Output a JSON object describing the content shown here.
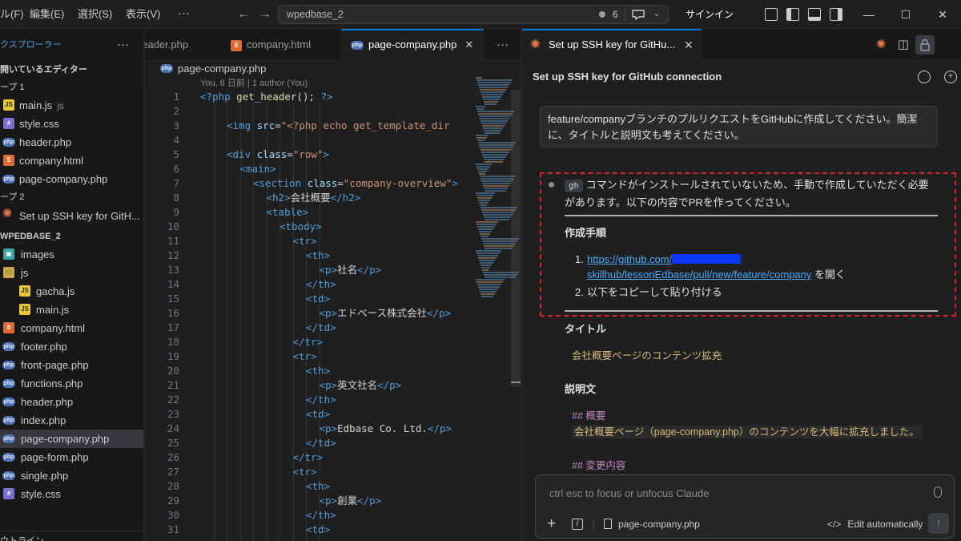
{
  "titlebar": {
    "menus": [
      "ル(F)",
      "編集(E)",
      "選択(S)",
      "表示(V)"
    ],
    "more": "···",
    "search_text": "wpedbase_2",
    "count": "6",
    "signin": "サインイン"
  },
  "sidebar": {
    "header": "クスプローラー",
    "open_editors": "開いているエディター",
    "group1": "ープ 1",
    "group1_items": [
      {
        "label": "main.js",
        "suffix": "js",
        "type": "js"
      },
      {
        "label": "style.css",
        "type": "css"
      },
      {
        "label": "header.php",
        "type": "php"
      },
      {
        "label": "company.html",
        "type": "html"
      },
      {
        "label": "page-company.php",
        "type": "php"
      }
    ],
    "group2": "ープ 2",
    "group2_items": [
      {
        "label": "Set up SSH key for GitH...",
        "type": "claude"
      }
    ],
    "project": "WPEDBASE_2",
    "tree": [
      {
        "label": "images",
        "type": "img",
        "indent": 0
      },
      {
        "label": "js",
        "type": "fold",
        "indent": 0
      },
      {
        "label": "gacha.js",
        "type": "js",
        "indent": 1
      },
      {
        "label": "main.js",
        "type": "js",
        "indent": 1
      },
      {
        "label": "company.html",
        "type": "html",
        "indent": 0
      },
      {
        "label": "footer.php",
        "type": "php",
        "indent": 0
      },
      {
        "label": "front-page.php",
        "type": "php",
        "indent": 0
      },
      {
        "label": "functions.php",
        "type": "php",
        "indent": 0
      },
      {
        "label": "header.php",
        "type": "php",
        "indent": 0
      },
      {
        "label": "index.php",
        "type": "php",
        "indent": 0
      },
      {
        "label": "page-company.php",
        "type": "php",
        "indent": 0,
        "active": true
      },
      {
        "label": "page-form.php",
        "type": "php",
        "indent": 0
      },
      {
        "label": "single.php",
        "type": "php",
        "indent": 0
      },
      {
        "label": "style.css",
        "type": "css",
        "indent": 0
      }
    ],
    "outline": "ウトライン"
  },
  "editor": {
    "tabs": [
      {
        "label": "header.php",
        "type": "php"
      },
      {
        "label": "company.html",
        "type": "html"
      },
      {
        "label": "page-company.php",
        "type": "php",
        "active": true
      }
    ],
    "breadcrumb": "page-company.php",
    "blame": "You, 6 日前 | 1 author (You)",
    "lines": [
      "1",
      "2",
      "3",
      "4",
      "5",
      "6",
      "7",
      "8",
      "9",
      "10",
      "11",
      "12",
      "13",
      "14",
      "15",
      "16",
      "17",
      "18",
      "19",
      "20",
      "21",
      "22",
      "23",
      "24",
      "25",
      "26",
      "27",
      "28",
      "29",
      "30",
      "31"
    ],
    "code": [
      {
        "i": 0,
        "parts": [
          [
            "php",
            "<?php "
          ],
          [
            "f",
            "get_header"
          ],
          [
            "w",
            "(); "
          ],
          [
            "php",
            "?>"
          ]
        ]
      },
      {
        "i": 0,
        "parts": []
      },
      {
        "i": 2,
        "parts": [
          [
            "t",
            "<img "
          ],
          [
            "a",
            "src"
          ],
          [
            "w",
            "="
          ],
          [
            "s",
            "\"<?php echo get_template_dir"
          ]
        ]
      },
      {
        "i": 0,
        "parts": []
      },
      {
        "i": 2,
        "parts": [
          [
            "t",
            "<div "
          ],
          [
            "a",
            "class"
          ],
          [
            "w",
            "="
          ],
          [
            "s",
            "\"row\""
          ],
          [
            "t",
            ">"
          ]
        ]
      },
      {
        "i": 3,
        "parts": [
          [
            "t",
            "<main>"
          ]
        ]
      },
      {
        "i": 4,
        "parts": [
          [
            "t",
            "<section "
          ],
          [
            "a",
            "class"
          ],
          [
            "w",
            "="
          ],
          [
            "s",
            "\"company-overview\""
          ],
          [
            "t",
            ">"
          ]
        ]
      },
      {
        "i": 5,
        "parts": [
          [
            "t",
            "<h2>"
          ],
          [
            "w",
            "会社概要"
          ],
          [
            "t",
            "</h2>"
          ]
        ]
      },
      {
        "i": 5,
        "parts": [
          [
            "t",
            "<table>"
          ]
        ]
      },
      {
        "i": 6,
        "parts": [
          [
            "t",
            "<tbody>"
          ]
        ]
      },
      {
        "i": 7,
        "parts": [
          [
            "t",
            "<tr>"
          ]
        ]
      },
      {
        "i": 8,
        "parts": [
          [
            "t",
            "<th>"
          ]
        ]
      },
      {
        "i": 9,
        "parts": [
          [
            "t",
            "<p>"
          ],
          [
            "w",
            "社名"
          ],
          [
            "t",
            "</p>"
          ]
        ]
      },
      {
        "i": 8,
        "parts": [
          [
            "t",
            "</th>"
          ]
        ]
      },
      {
        "i": 8,
        "parts": [
          [
            "t",
            "<td>"
          ]
        ]
      },
      {
        "i": 9,
        "parts": [
          [
            "t",
            "<p>"
          ],
          [
            "w",
            "エドベース株式会社"
          ],
          [
            "t",
            "</p>"
          ]
        ]
      },
      {
        "i": 8,
        "parts": [
          [
            "t",
            "</td>"
          ]
        ]
      },
      {
        "i": 7,
        "parts": [
          [
            "t",
            "</tr>"
          ]
        ]
      },
      {
        "i": 7,
        "parts": [
          [
            "t",
            "<tr>"
          ]
        ]
      },
      {
        "i": 8,
        "parts": [
          [
            "t",
            "<th>"
          ]
        ]
      },
      {
        "i": 9,
        "parts": [
          [
            "t",
            "<p>"
          ],
          [
            "w",
            "英文社名"
          ],
          [
            "t",
            "</p>"
          ]
        ]
      },
      {
        "i": 8,
        "parts": [
          [
            "t",
            "</th>"
          ]
        ]
      },
      {
        "i": 8,
        "parts": [
          [
            "t",
            "<td>"
          ]
        ]
      },
      {
        "i": 9,
        "parts": [
          [
            "t",
            "<p>"
          ],
          [
            "w",
            "Edbase Co. Ltd."
          ],
          [
            "t",
            "</p>"
          ]
        ]
      },
      {
        "i": 8,
        "parts": [
          [
            "t",
            "</td>"
          ]
        ]
      },
      {
        "i": 7,
        "parts": [
          [
            "t",
            "</tr>"
          ]
        ]
      },
      {
        "i": 7,
        "parts": [
          [
            "t",
            "<tr>"
          ]
        ]
      },
      {
        "i": 8,
        "parts": [
          [
            "t",
            "<th>"
          ]
        ]
      },
      {
        "i": 9,
        "parts": [
          [
            "t",
            "<p>"
          ],
          [
            "w",
            "創業"
          ],
          [
            "t",
            "</p>"
          ]
        ]
      },
      {
        "i": 8,
        "parts": [
          [
            "t",
            "</th>"
          ]
        ]
      },
      {
        "i": 8,
        "parts": [
          [
            "t",
            "<td>"
          ]
        ]
      }
    ]
  },
  "panel": {
    "tab_label": "Set up SSH key for GitHu...",
    "title": "Set up SSH key for GitHub connection",
    "user_message": "feature/companyブランチのプルリクエストをGitHubに作成してください。簡潔に、タイトルと説明文も考えてください。",
    "reply_chip": "gh",
    "reply_text": "コマンドがインストールされていないため、手動で作成していただく必要があります。以下の内容でPRを作ってください。",
    "steps_heading": "作成手順",
    "step1_num": "1.",
    "step1_link_a": "https://github.com/",
    "step1_link_b": "skillhub/lessonEdbase/pull/new/feature/company",
    "step1_suffix": " を開く",
    "step2_num": "2.",
    "step2_text": "以下をコピーして貼り付ける",
    "title_heading": "タイトル",
    "title_value": "会社概要ページのコンテンツ拡充",
    "desc_heading": "説明文",
    "md_h1": "## 概要",
    "md_p1": "会社概要ページ（page-company.php）のコンテンツを大幅に拡充しました。",
    "md_h2": "## 変更内容",
    "input_placeholder": "ctrl esc to focus or unfocus Claude",
    "file_chip": "page-company.php",
    "edit_mode": "Edit automatically"
  }
}
